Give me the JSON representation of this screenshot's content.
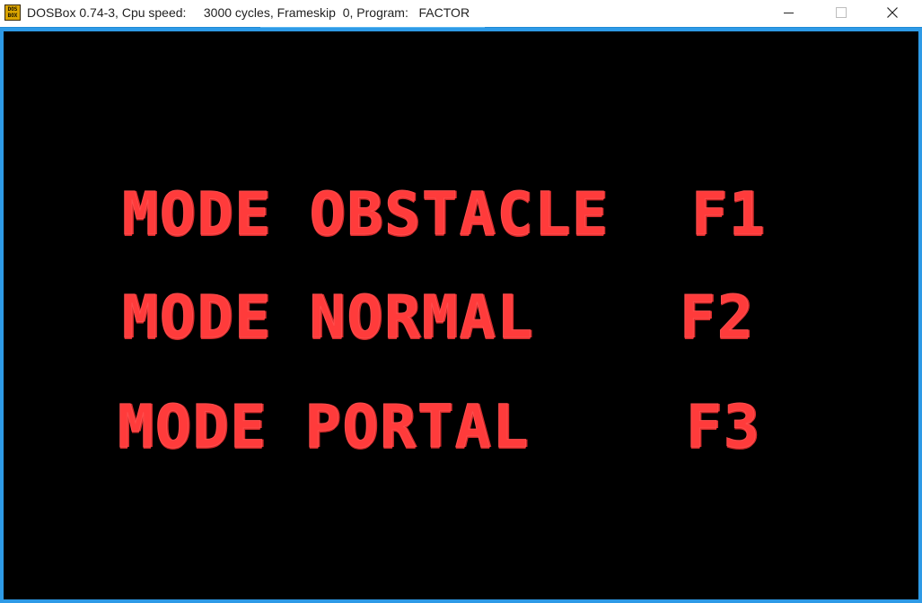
{
  "window": {
    "title": "DOSBox 0.74-3, Cpu speed:     3000 cycles, Frameskip  0, Program:   FACTOR",
    "icon_text": "DOS BOX",
    "icon_name": "dosbox-app-icon",
    "controls": {
      "minimize_icon": "minimize-icon",
      "maximize_icon": "maximize-icon",
      "close_icon": "close-icon"
    },
    "colors": {
      "client_background": "#000000",
      "frame_border": "#2e9ae6",
      "text_color": "#ff3b3b"
    }
  },
  "menu": {
    "items": [
      {
        "label": "MODE OBSTACLE",
        "key": "F1"
      },
      {
        "label": "MODE NORMAL",
        "key": "F2"
      },
      {
        "label": "MODE PORTAL",
        "key": "F3"
      }
    ]
  }
}
